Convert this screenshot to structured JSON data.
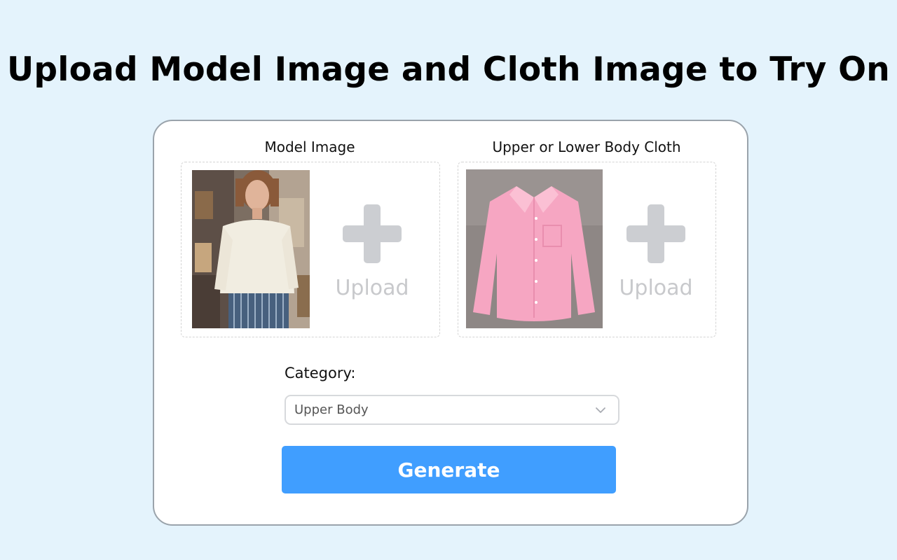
{
  "page": {
    "title": "Upload Model Image and Cloth Image to Try On"
  },
  "model_slot": {
    "label": "Model Image",
    "thumbnail": "woman-in-white-blouse-photo",
    "upload_icon": "plus-icon",
    "upload_label": "Upload"
  },
  "cloth_slot": {
    "label": "Upper or Lower Body Cloth",
    "thumbnail": "pink-shirt-photo",
    "upload_icon": "plus-icon",
    "upload_label": "Upload"
  },
  "category": {
    "label": "Category:",
    "selected": "Upper Body",
    "dropdown_icon": "chevron-down-icon"
  },
  "actions": {
    "generate_label": "Generate"
  },
  "colors": {
    "background": "#e4f3fc",
    "accent": "#409eff",
    "placeholder_gray": "#ccced2"
  }
}
